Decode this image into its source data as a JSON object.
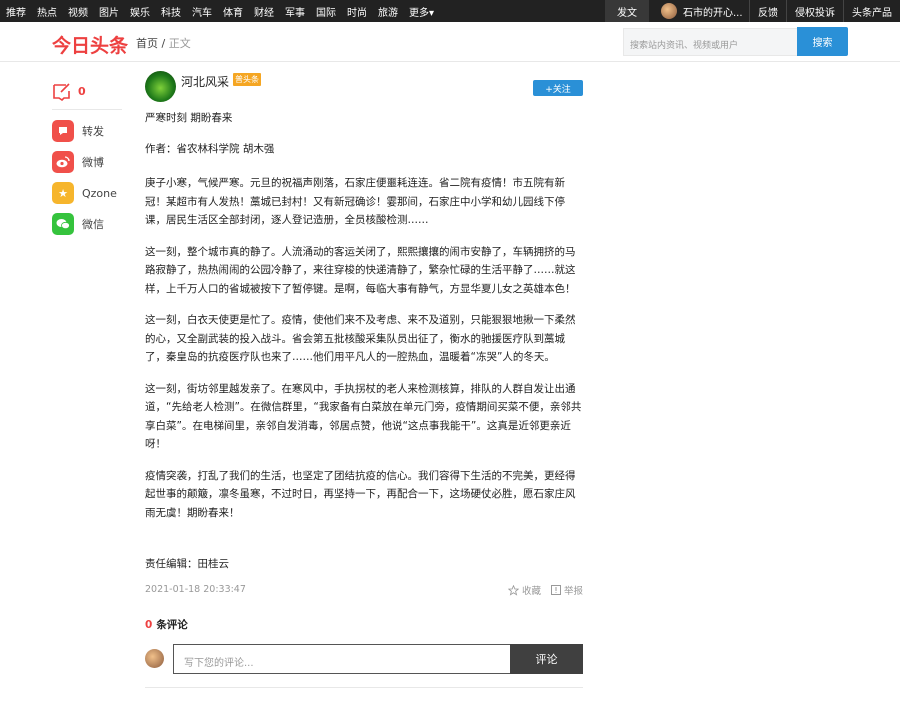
{
  "topbar": {
    "nav": [
      "推荐",
      "热点",
      "视频",
      "图片",
      "娱乐",
      "科技",
      "汽车",
      "体育",
      "财经",
      "军事",
      "国际",
      "时尚",
      "旅游",
      "更多▾"
    ],
    "post_label": "发文",
    "username": "石市的开心...",
    "feedback": "反馈",
    "complaint": "侵权投诉",
    "products": "头条产品"
  },
  "header": {
    "logo": "今日头条",
    "crumb_home": "首页",
    "crumb_sep": "/",
    "crumb_current": "正文",
    "search_placeholder": "搜索站内资讯、视频或用户",
    "search_button": "搜索"
  },
  "rail": {
    "comment_count": "0",
    "shares": [
      {
        "label": "转发",
        "icon": "forward-icon",
        "color": "#f0504a"
      },
      {
        "label": "微博",
        "icon": "weibo-icon",
        "color": "#f0504a"
      },
      {
        "label": "Qzone",
        "icon": "qzone-icon",
        "color": "#f6b52c"
      },
      {
        "label": "微信",
        "icon": "wechat-icon",
        "color": "#35c33d"
      }
    ]
  },
  "article": {
    "author_name": "河北风采",
    "author_badge": "普头条",
    "follow_label": "+关注",
    "subtitle": "严寒时刻 期盼春来",
    "byline": "作者：省农林科学院 胡木强",
    "paragraphs": [
      "庚子小寒，气候严寒。元旦的祝福声刚落，石家庄便噩耗连连。省二院有疫情！市五院有新冠！某超市有人发热！藁城已封村！又有新冠确诊！霎那间，石家庄中小学和幼儿园线下停课，居民生活区全部封闭，逐人登记造册，全员核酸检测……",
      "这一刻，整个城市真的静了。人流涌动的客运关闭了，熙熙攘攘的闹市安静了，车辆拥挤的马路寂静了，热热闹闹的公园冷静了，来往穿梭的快递清静了，繁杂忙碌的生活平静了……就这样，上千万人口的省城被按下了暂停键。是啊，每临大事有静气，方显华夏儿女之英雄本色！",
      "这一刻，白衣天使更是忙了。疫情，使他们来不及考虑、来不及道别，只能狠狠地揪一下柔然的心，又全副武装的投入战斗。省会第五批核酸采集队员出征了，衡水的驰援医疗队到藁城了，秦皇岛的抗疫医疗队也来了……他们用平凡人的一腔热血，温暖着“冻哭”人的冬天。",
      "这一刻，街坊邻里越发亲了。在寒风中，手执拐杖的老人来检测核算，排队的人群自发让出通道，“先给老人检测”。在微信群里，“我家备有白菜放在单元门旁，疫情期间买菜不便，亲邻共享白菜”。在电梯间里，亲邻自发消毒，邻居点赞，他说“这点事我能干”。这真是近邻更亲近呀！",
      "疫情突袭，打乱了我们的生活，也坚定了团结抗疫的信心。我们容得下生活的不完美，更经得起世事的颠簸，凛冬虽寒，不过时日，再坚持一下，再配合一下，这场硬仗必胜，愿石家庄风雨无虞！期盼春来！"
    ],
    "editor": "责任编辑：田桂云",
    "timestamp": "2021-01-18 20:33:47",
    "favorite_label": "收藏",
    "report_label": "举报"
  },
  "comments": {
    "count": "0",
    "title": "条评论",
    "placeholder": "写下您的评论...",
    "submit": "评论"
  }
}
